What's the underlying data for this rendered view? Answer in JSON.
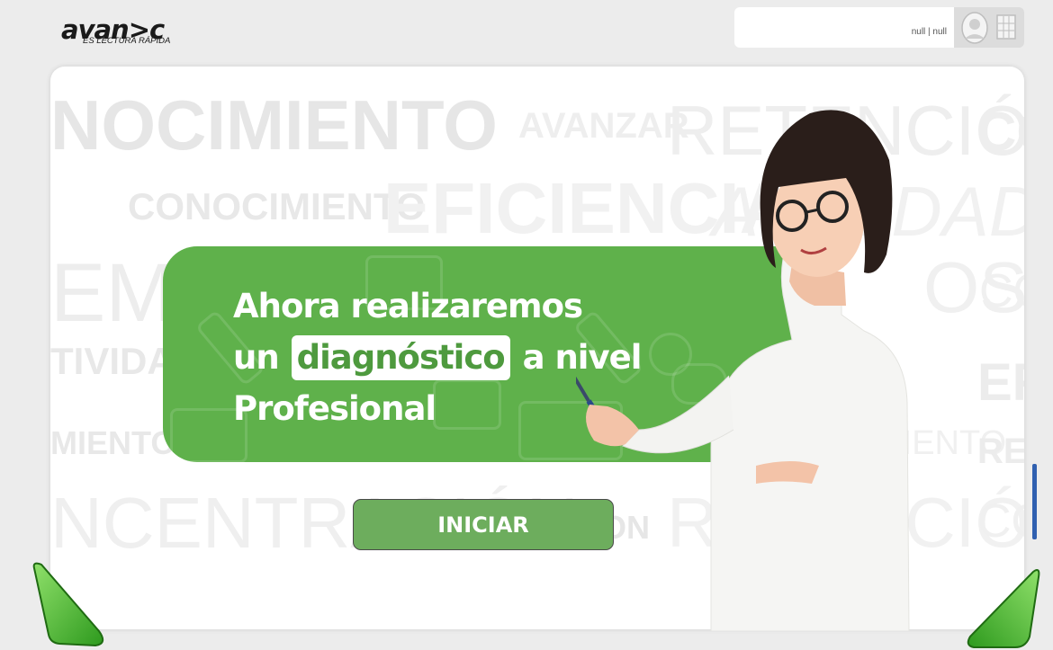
{
  "brand": {
    "name": "avan>c",
    "tagline": "ES LECTURA RÁPIDA"
  },
  "user": {
    "label": "null | null"
  },
  "icons": {
    "user": "avatar-icon",
    "menu": "grid-menu-icon"
  },
  "background_words": [
    "NOCIMIENTO",
    "AVANZAR",
    "RETENCIÓN",
    "CO",
    "CONOCIMIENTO",
    "EFICIENCIA",
    "AGILIDAD",
    "EMPO",
    "OS",
    "CO",
    "TIVIDAD",
    "EF",
    "MIENTO",
    "MIENTO",
    "REN",
    "NCENTRACIÓN",
    "ON",
    "RETENCIÓN",
    "CO"
  ],
  "banner": {
    "line1": "Ahora realizaremos",
    "line2_pre": "un",
    "line2_highlight": "diagnóstico",
    "line2_post": "a nivel",
    "line3": "Profesional"
  },
  "buttons": {
    "start": "INICIAR"
  },
  "colors": {
    "banner": "#5fb14b",
    "button": "#6dad5d",
    "nav_arrows": "#5cc23d"
  }
}
